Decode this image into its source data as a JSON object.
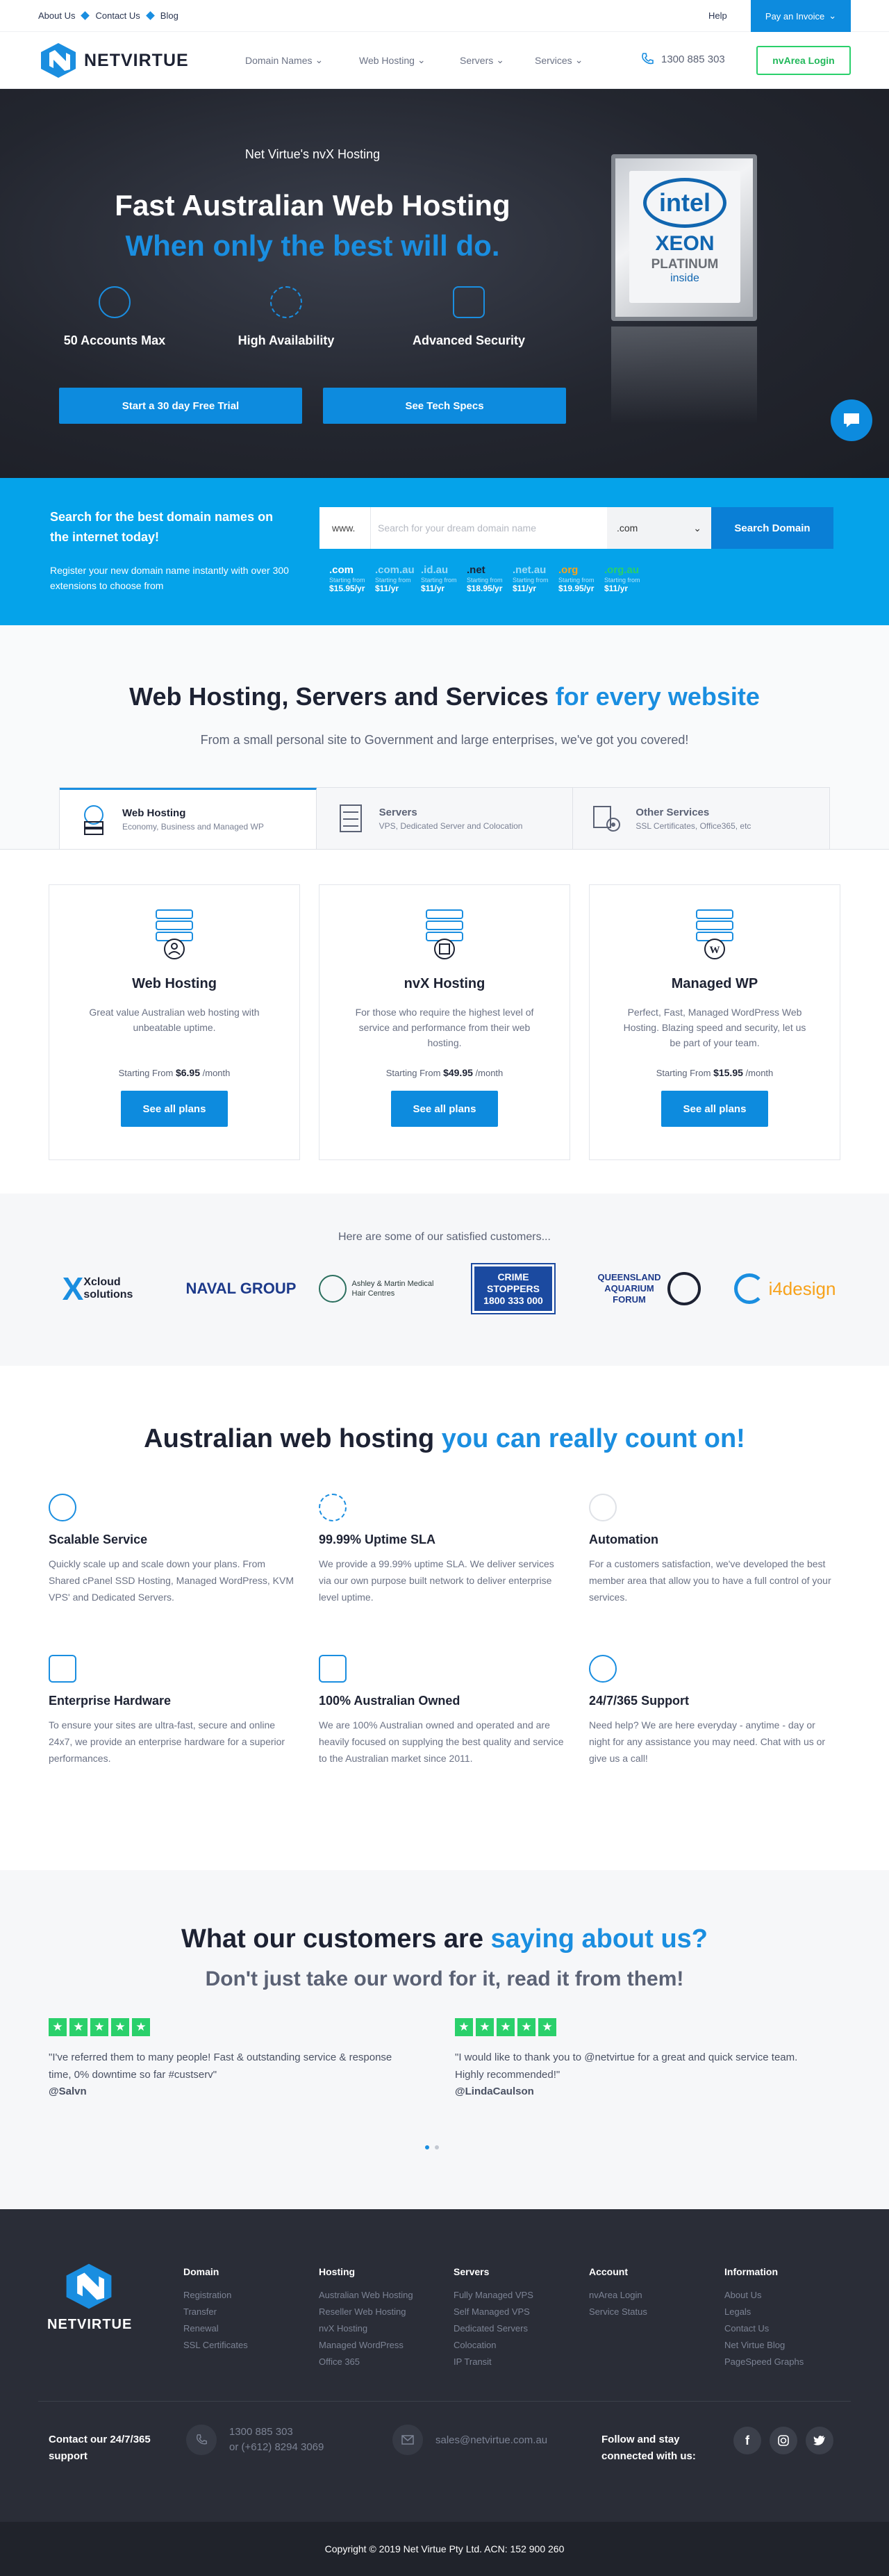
{
  "topbar": {
    "links": [
      "About Us",
      "Contact Us",
      "Blog"
    ],
    "help": "Help",
    "pay_invoice": "Pay an Invoice"
  },
  "header": {
    "brand": "NETVIRTUE",
    "nav": [
      "Domain Names",
      "Web Hosting",
      "Servers",
      "Services"
    ],
    "phone": "1300 885 303",
    "login": "nvArea Login"
  },
  "hero": {
    "subtitle": "Net Virtue's nvX Hosting",
    "title": "Fast Australian Web Hosting",
    "tagline": "When only the best will do.",
    "features": [
      "50 Accounts Max",
      "High Availability",
      "Advanced Security"
    ],
    "cta_trial": "Start a 30 day Free Trial",
    "cta_specs": "See Tech Specs",
    "chip": {
      "brand": "intel",
      "model": "XEON",
      "tier": "PLATINUM",
      "inside": "inside"
    }
  },
  "domain": {
    "title": "Search for the best domain names on the internet today!",
    "desc": "Register your new domain name instantly with over 300 extensions to choose from",
    "prefix": "www.",
    "placeholder": "Search for your dream domain name",
    "ext": ".com",
    "button": "Search Domain",
    "tlds": [
      {
        "name": ".com",
        "label": "Starting from",
        "price": "$15.95/yr"
      },
      {
        "name": ".com.au",
        "label": "Starting from",
        "price": "$11/yr"
      },
      {
        "name": ".id.au",
        "label": "Starting from",
        "price": "$11/yr"
      },
      {
        "name": ".net",
        "label": "Starting from",
        "price": "$18.95/yr"
      },
      {
        "name": ".net.au",
        "label": "Starting from",
        "price": "$11/yr"
      },
      {
        "name": ".org",
        "label": "Starting from",
        "price": "$19.95/yr"
      },
      {
        "name": ".org.au",
        "label": "Starting from",
        "price": "$11/yr"
      }
    ]
  },
  "services": {
    "heading": "Web Hosting, Servers and Services",
    "heading_hl": "for every website",
    "subheading": "From a small personal site to Government and large enterprises, we've got you covered!",
    "tabs": [
      {
        "title": "Web Hosting",
        "desc": "Economy, Business and Managed WP"
      },
      {
        "title": "Servers",
        "desc": "VPS, Dedicated Server and Colocation"
      },
      {
        "title": "Other Services",
        "desc": "SSL Certificates, Office365, etc"
      }
    ],
    "plans": [
      {
        "title": "Web Hosting",
        "desc": "Great value Australian web hosting with unbeatable uptime.",
        "price_label": "Starting From",
        "price": "$6.95",
        "per": "/month",
        "button": "See all plans"
      },
      {
        "title": "nvX Hosting",
        "desc": "For those who require the highest level of service and performance from their web hosting.",
        "price_label": "Starting From",
        "price": "$49.95",
        "per": "/month",
        "button": "See all plans"
      },
      {
        "title": "Managed WP",
        "desc": "Perfect, Fast, Managed WordPress Web Hosting. Blazing speed and security, let us be part of your team.",
        "price_label": "Starting From",
        "price": "$15.95",
        "per": "/month",
        "button": "See all plans"
      }
    ]
  },
  "customers": {
    "title": "Here are some of our satisfied customers...",
    "logos": [
      "Xcloud solutions",
      "NAVAL GROUP",
      "Ashley & Martin Medical Hair Centres",
      "CRIME STOPPERS 1800 333 000",
      "QUEENSLAND AQUARIUM FORUM",
      "i4design"
    ]
  },
  "count": {
    "heading": "Australian web hosting",
    "heading_hl": "you can really count on!",
    "features": [
      {
        "title": "Scalable Service",
        "desc": "Quickly scale up and scale down your plans. From Shared cPanel SSD Hosting, Managed WordPress, KVM VPS' and Dedicated Servers."
      },
      {
        "title": "99.99% Uptime SLA",
        "desc": "We provide a 99.99% uptime SLA. We deliver services via our own purpose built network to deliver enterprise level uptime."
      },
      {
        "title": "Automation",
        "desc": "For a customers satisfaction, we've developed the best member area that allow you to have a full control of your services."
      },
      {
        "title": "Enterprise Hardware",
        "desc": "To ensure your sites are ultra-fast, secure and online 24x7, we provide an enterprise hardware for a superior performances."
      },
      {
        "title": "100% Australian Owned",
        "desc": "We are 100% Australian owned and operated and are heavily focused on supplying the best quality and service to the Australian market since 2011."
      },
      {
        "title": "24/7/365 Support",
        "desc": "Need help? We are here everyday - anytime - day or night for any assistance you may need. Chat with us or give us a call!"
      }
    ]
  },
  "testimonials": {
    "heading": "What our customers are",
    "heading_hl": "saying about us?",
    "subheading": "Don't just take our word for it, read it from them!",
    "items": [
      {
        "quote": "\"I've referred them to many people! Fast & outstanding service & response time, 0% downtime so far #custserv\"",
        "author": "@Salvn",
        "stars": 5
      },
      {
        "quote": "\"I would like to thank you to @netvirtue for a great and quick service team. Highly recommended!\"",
        "author": "@LindaCaulson",
        "stars": 5
      }
    ]
  },
  "footer": {
    "brand": "NETVIRTUE",
    "columns": [
      {
        "title": "Domain",
        "items": [
          "Registration",
          "Transfer",
          "Renewal",
          "SSL Certificates"
        ]
      },
      {
        "title": "Hosting",
        "items": [
          "Australian Web Hosting",
          "Reseller Web Hosting",
          "nvX Hosting",
          "Managed WordPress",
          "Office 365"
        ]
      },
      {
        "title": "Servers",
        "items": [
          "Fully Managed VPS",
          "Self Managed VPS",
          "Dedicated Servers",
          "Colocation",
          "IP Transit"
        ]
      },
      {
        "title": "Account",
        "items": [
          "nvArea Login",
          "Service Status"
        ]
      },
      {
        "title": "Information",
        "items": [
          "About Us",
          "Legals",
          "Contact Us",
          "Net Virtue Blog",
          "PageSpeed Graphs"
        ]
      }
    ],
    "contact_label": "Contact our 24/7/365 support",
    "phone1": "1300 885 303",
    "phone2": "or (+612) 8294 3069",
    "email": "sales@netvirtue.com.au",
    "follow_label": "Follow and stay connected with us:",
    "copyright": "Copyright © 2019 Net Virtue Pty Ltd. ACN: 152 900 260"
  },
  "colors": {
    "accent": "#1a8ee0",
    "domain_bg": "#05a3ea",
    "hero_bg": "#23262f",
    "footer_bg": "#2a2d37",
    "green": "#2ad06b"
  }
}
